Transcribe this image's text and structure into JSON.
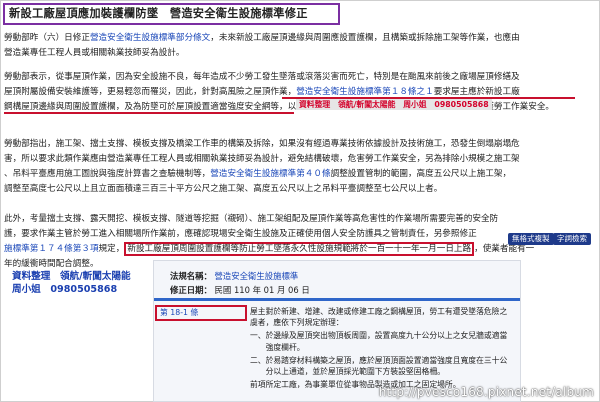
{
  "title": "新設工廠屋頂應加裝護欄防墜　營造安全衛生設施標準修正",
  "p1": {
    "l1_a": "勞動部昨（六）日修正",
    "l1_link": "營造安全衛生設施標準部分條文",
    "l1_b": "，未來新設工廠屋頂邊緣與周圍應設置護欄，且構築或拆除施工架等作業，也應由",
    "l2": "營造業專任工程人員或相關執業技師妥為設計。"
  },
  "p2": {
    "l1": "勞動部表示，從事屋頂作業，因為安全設施不良，每年造成不少勞工發生墜落或滾落災害而死亡，特別是在颱風來前後之廠場屋頂修繕及",
    "l2_a": "屋頂附屬設備安裝維護等，更易輕忽而罹災，因此，針對高風險之屋頂作業，",
    "l2_link": "營造安全衛生設施標準第１８條之１",
    "l2_b": "要求屋主應於新設工廠",
    "l3": "鋼構屋頂邊緣與周圍設置護欄，及為防墜可於屋頂設置適當強度安全網等，以強化屋頂作業勞工墜落永久性設施，以源頭管理保護勞工作業安全。"
  },
  "stamp_middle": "資料整理　領航/斬闖太陽能　周小姐　0980505868",
  "p3": {
    "l1": "勞動部指出，施工架、擋土支撐、模板支撐及橋梁工作車的構築及拆除，如果沒有經過專業技術依據設計及技術施工，恐發生倒塌崩塌危",
    "l2": "害，所以要求此類作業應由營造業專任工程人員或相關執業技師妥為設計，避免結構破壞，危害勞工作業安全，另為排除小規模之施工架",
    "l3_a": "、吊料平臺應用施工圖說與強度計算書之查驗機制等，",
    "l3_link": "營造安全衛生設施標準第４０條",
    "l3_b": "調整設置管制的範圍，高度五公尺以上施工架，",
    "l4": "調整至高度七公尺以上且立面面積達三百三十平方公尺之施工架、高度五公尺以上之吊料平臺調整至七公尺以上者。"
  },
  "p4": {
    "l1": "此外，考量擋土支撐、露天開挖、模板支撐、隧道等挖掘（襯砌）、施工架組配及屋頂作業等高危害性的作業場所需要完善的安全防",
    "l2_a": "護，要求作業主管於勞工進入相關場所作業前，應確認現場安全衛生設施及正確使用個人安全防護具之管制責任，另參照修正",
    "l3_link": "施標準第１７４條第３項",
    "l3_a": "規定，",
    "l3_box": "新設工廠屋頂周圍設置護欄等防止勞工墜落永久性設施規範將於一百一十一年一月一日上路",
    "l3_b": "，使業者能有一",
    "l4": "年的緩衝時間配合調整。"
  },
  "stamp_copy": "無格式複製",
  "stamp_search": "字詞檢索",
  "credit": {
    "line1": "資料整理　領航/斬闖太陽能",
    "line2": "周小姐　0980505868"
  },
  "law": {
    "name_label": "法規名稱：",
    "name_link": "營造安全衛生設施標準",
    "date_label": "修正日期：",
    "date_value": "民國 110 年 01 月 06 日",
    "article_label": "第 18-1 條",
    "items": [
      "屋主對於新建、增建、改建或修建工廠之鋼構屋頂，勞工有遭受墜落危險之",
      "虞者，應依下列規定辦理：",
      "一、於邊緣及屋頂突出物頂板周圍，設置高度九十公分以上之女兒牆或適當",
      "　　強度欄杆。",
      "二、於易踏穿材料構築之屋頂，應於屋頂頂面設置適當強度且寬度在三十公",
      "　　分以上通道，並於屋頂採光範圍下方裝設堅固格柵。",
      "前項所定工廠，為事業單位從事物品製造或加工之固定場所。"
    ]
  },
  "watermark": "http://pvesco168.pixnet.net/album",
  "colors": {
    "title_border": "#7b2fa2",
    "link": "#1a47b8",
    "highlight_red": "#c8102e",
    "credit_blue": "#1a3fb0",
    "law_rule": "#2f66c9"
  }
}
